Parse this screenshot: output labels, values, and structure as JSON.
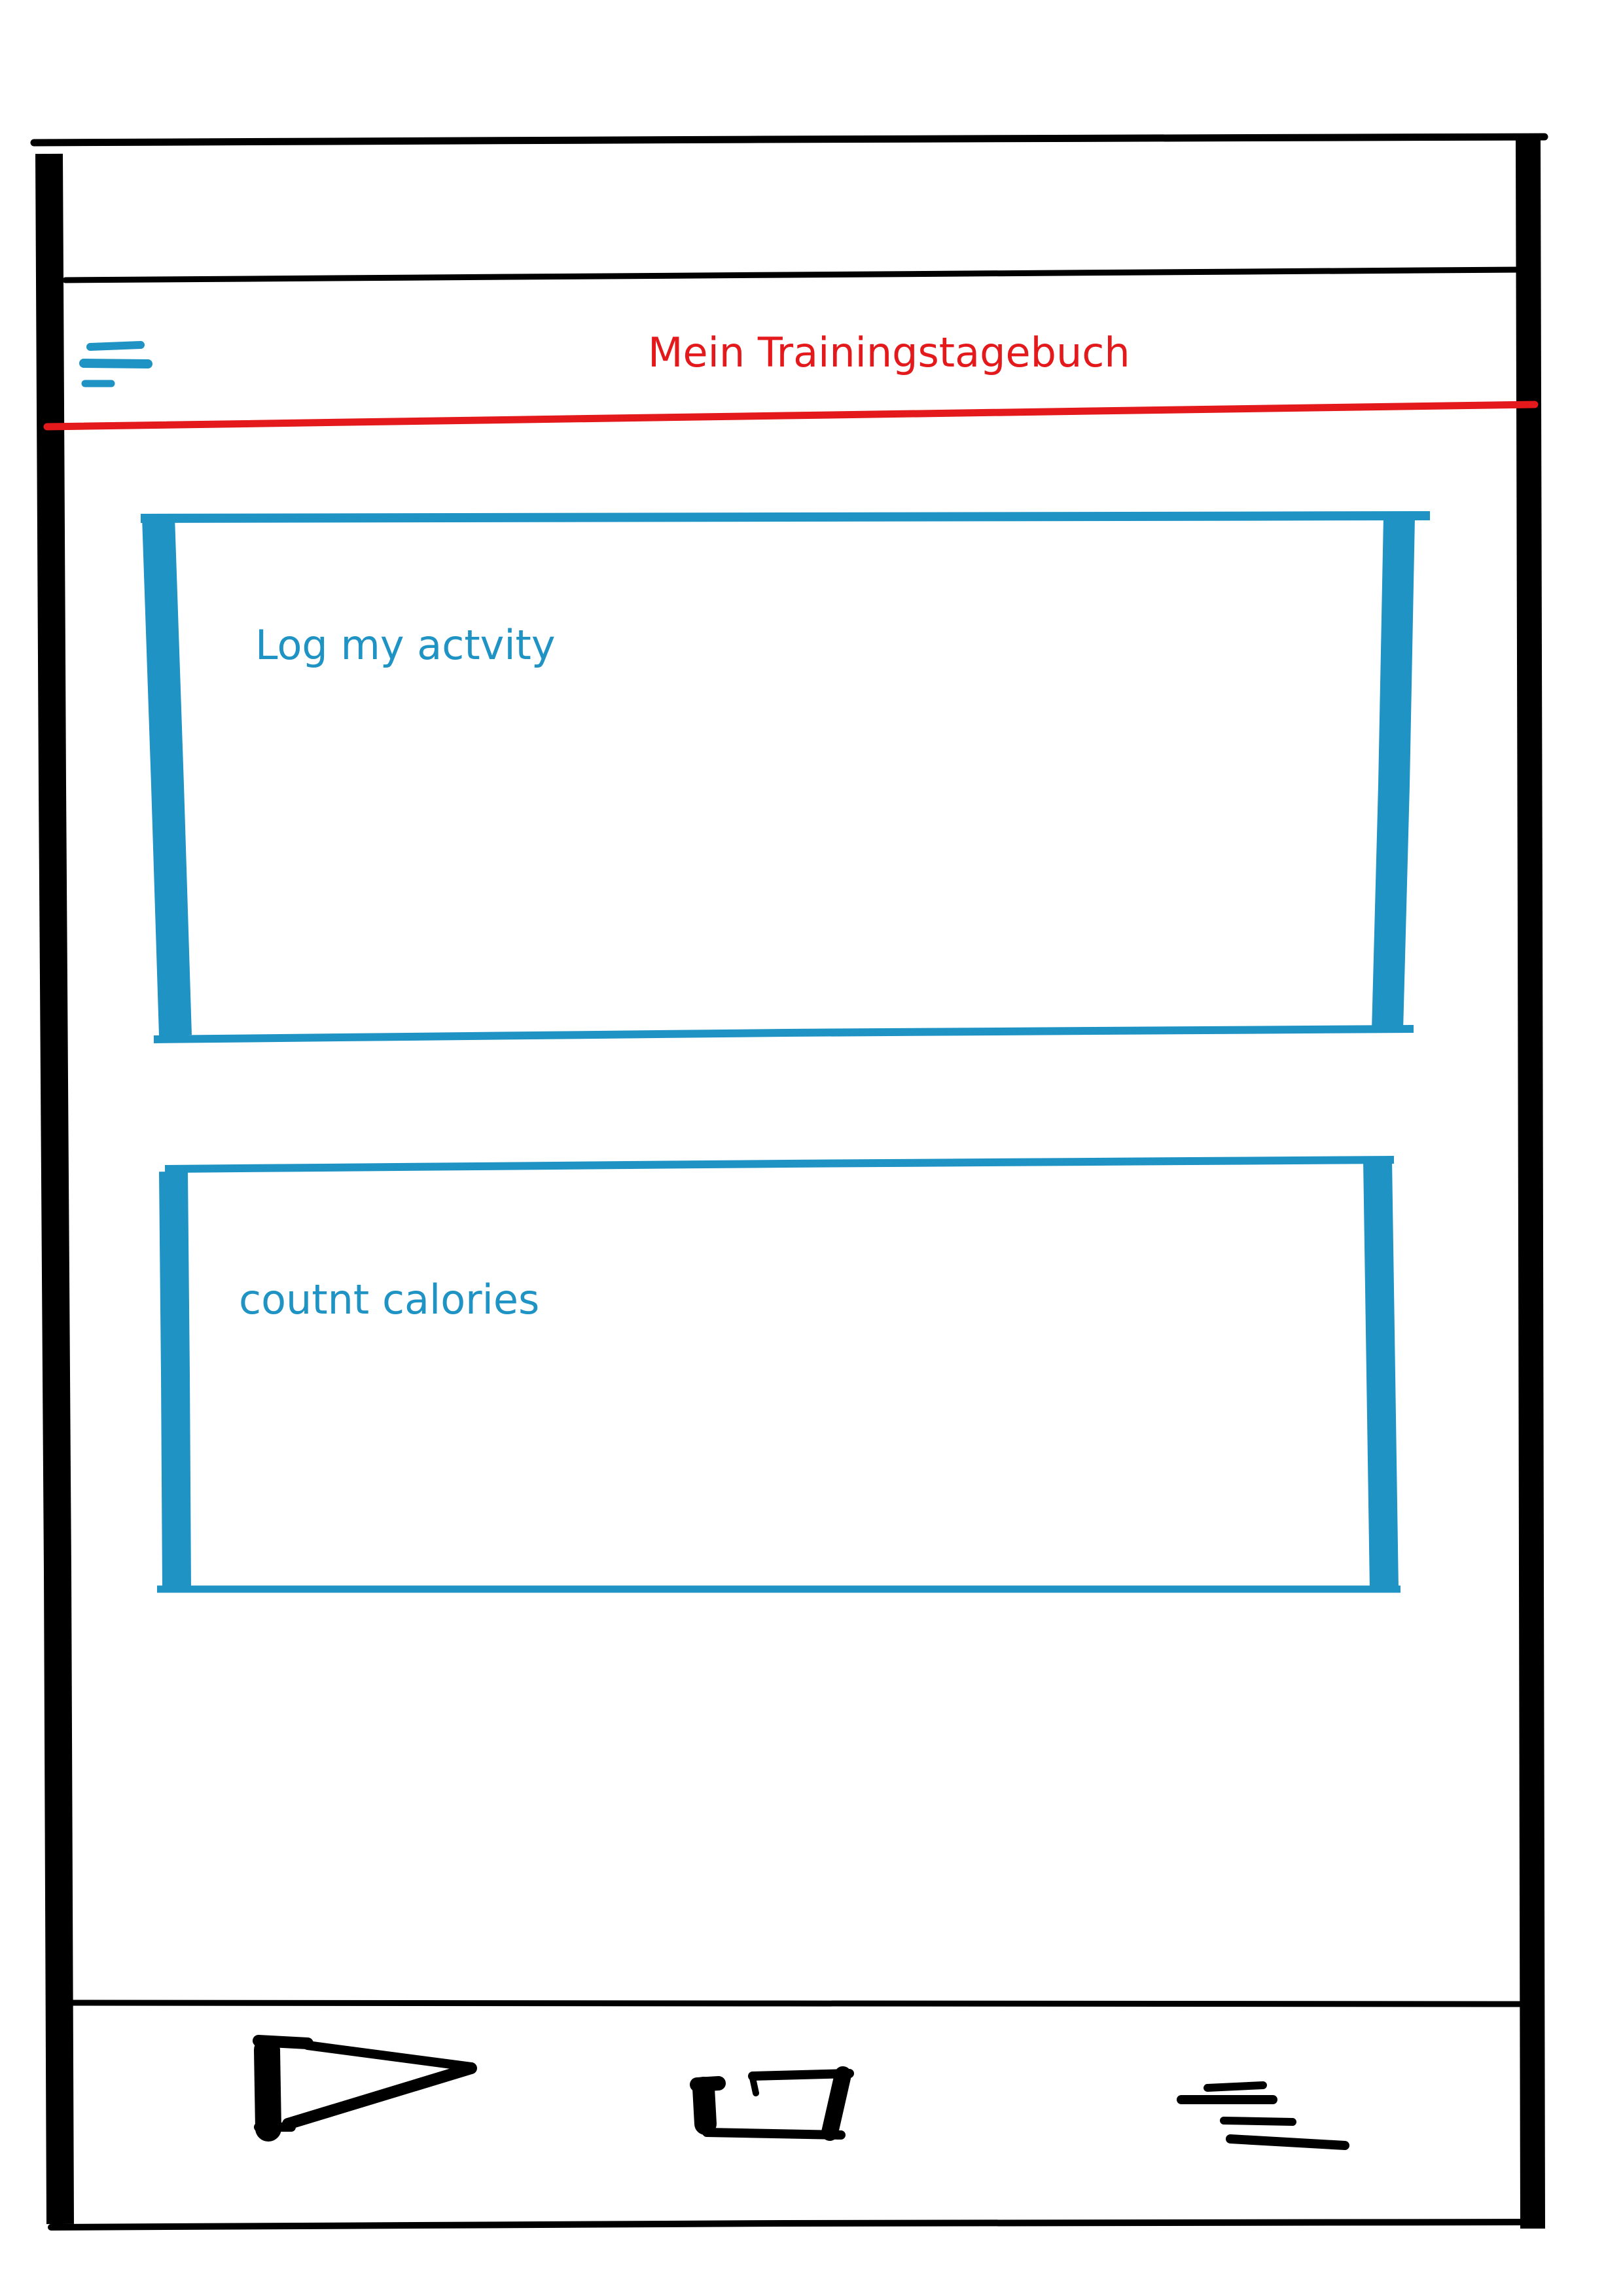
{
  "header": {
    "title": "Mein Trainingstagebuch",
    "menu_icon": "hamburger-menu-icon"
  },
  "cards": [
    {
      "label": "Log my actvity"
    },
    {
      "label": "coutnt calories"
    }
  ],
  "bottom_nav": {
    "items": [
      {
        "icon": "play-icon"
      },
      {
        "icon": "square-icon"
      },
      {
        "icon": "menu-icon"
      }
    ]
  },
  "colors": {
    "frame": "#000000",
    "accent_blue": "#1f93c4",
    "title_red": "#e3191b",
    "background": "#ffffff"
  }
}
